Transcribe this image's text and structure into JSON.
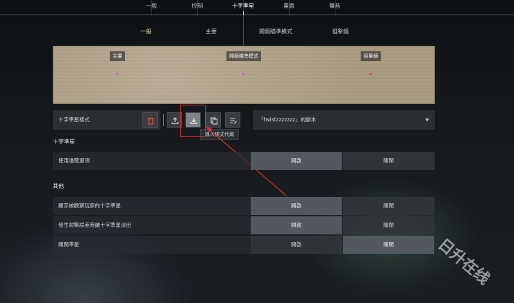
{
  "top_tabs": [
    "一般",
    "控制",
    "十字準星",
    "畫面",
    "聲音"
  ],
  "active_top_tab": "十字準星",
  "sub_tabs": [
    "一般",
    "主要",
    "開鏡瞄準模式",
    "狙擊鏡"
  ],
  "active_sub_tab": "一般",
  "preview": {
    "labels": [
      "主要",
      "開鏡瞄準模式",
      "狙擊鏡"
    ],
    "dot_colors": [
      "#d04cd0",
      "#d04cd0",
      "#e83a3a"
    ]
  },
  "toolbar": {
    "profile_label": "十字準星樣式",
    "icons": [
      "trash-icon",
      "export-icon",
      "import-icon",
      "copy-icon",
      "edit-list-icon"
    ],
    "tooltip": "導入樣式代碼",
    "profile_select": "「twistzzzzzzz」的副本"
  },
  "sections": [
    {
      "title": "十字準星",
      "rows": [
        {
          "label": "使用進階選項",
          "on": "開啟",
          "off": "關閉",
          "selected": "on"
        }
      ]
    },
    {
      "title": "其他",
      "rows": [
        {
          "label": "顯示被觀察玩家的十字準星",
          "on": "開啟",
          "off": "關閉",
          "selected": "on"
        },
        {
          "label": "發生射擊誤差時讓十字準星淡出",
          "on": "開啟",
          "off": "關閉",
          "selected": "on"
        },
        {
          "label": "關閉準星",
          "on": "開啟",
          "off": "關閉",
          "selected": "off"
        }
      ]
    }
  ],
  "colors": {
    "annotation": "#e0302a",
    "active_subtab": "#e8dfa3"
  },
  "watermark": "日升在线"
}
